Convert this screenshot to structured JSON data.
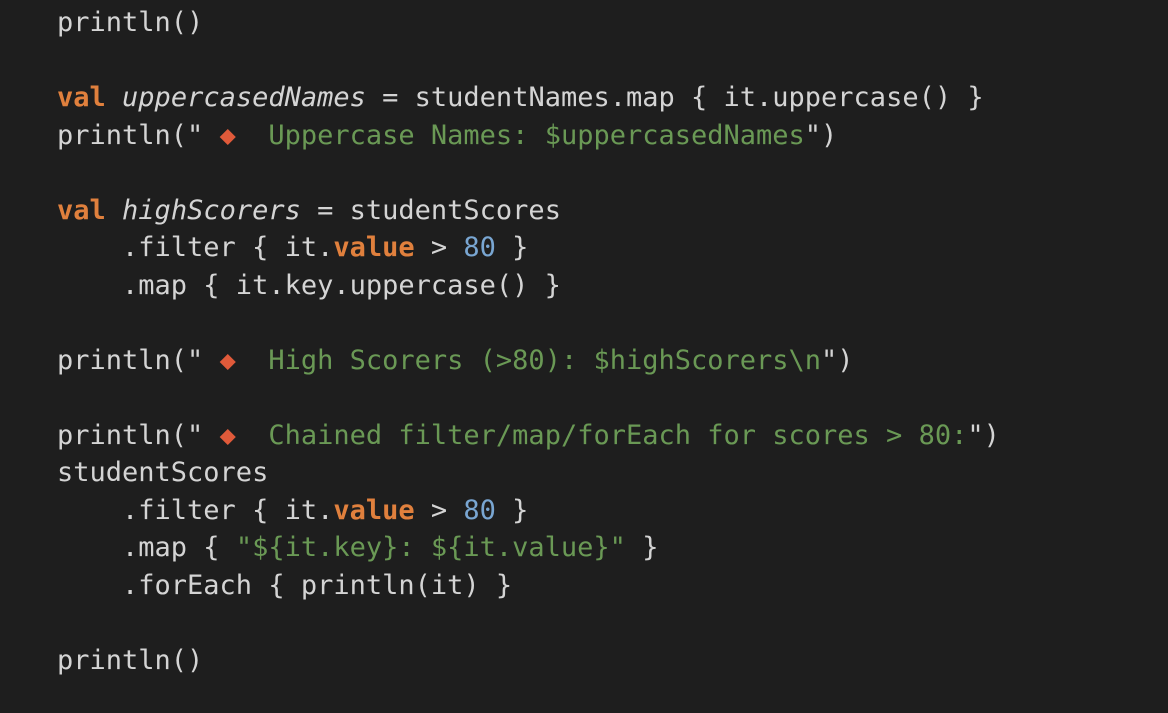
{
  "code_lines": [
    {
      "tokens": [
        {
          "text": "println()",
          "style": "plain"
        }
      ]
    },
    {
      "tokens": []
    },
    {
      "tokens": [
        {
          "text": "val",
          "style": "kw"
        },
        {
          "text": " ",
          "style": "plain"
        },
        {
          "text": "uppercasedNames",
          "style": "ital"
        },
        {
          "text": " = studentNames.map { it.uppercase() }",
          "style": "plain"
        }
      ]
    },
    {
      "tokens": [
        {
          "text": "println(\"",
          "style": "plain"
        },
        {
          "text": " ◆ ",
          "style": "diamond"
        },
        {
          "text": " Uppercase Names: $uppercasedNames",
          "style": "str"
        },
        {
          "text": "\")",
          "style": "plain"
        }
      ]
    },
    {
      "tokens": []
    },
    {
      "tokens": [
        {
          "text": "val",
          "style": "kw"
        },
        {
          "text": " ",
          "style": "plain"
        },
        {
          "text": "highScorers",
          "style": "ital"
        },
        {
          "text": " = studentScores",
          "style": "plain"
        }
      ]
    },
    {
      "tokens": [
        {
          "text": "    .filter { it.",
          "style": "plain"
        },
        {
          "text": "value",
          "style": "kw"
        },
        {
          "text": " > ",
          "style": "plain"
        },
        {
          "text": "80",
          "style": "num"
        },
        {
          "text": " }",
          "style": "plain"
        }
      ]
    },
    {
      "tokens": [
        {
          "text": "    .map { it.key.uppercase() }",
          "style": "plain"
        }
      ]
    },
    {
      "tokens": []
    },
    {
      "tokens": [
        {
          "text": "println(\"",
          "style": "plain"
        },
        {
          "text": " ◆ ",
          "style": "diamond"
        },
        {
          "text": " High Scorers (>80): $highScorers\\n",
          "style": "str"
        },
        {
          "text": "\")",
          "style": "plain"
        }
      ]
    },
    {
      "tokens": []
    },
    {
      "tokens": [
        {
          "text": "println(\"",
          "style": "plain"
        },
        {
          "text": " ◆ ",
          "style": "diamond"
        },
        {
          "text": " Chained filter/map/forEach for scores > 80:",
          "style": "str"
        },
        {
          "text": "\")",
          "style": "plain"
        }
      ]
    },
    {
      "tokens": [
        {
          "text": "studentScores",
          "style": "plain"
        }
      ]
    },
    {
      "tokens": [
        {
          "text": "    .filter { it.",
          "style": "plain"
        },
        {
          "text": "value",
          "style": "kw"
        },
        {
          "text": " > ",
          "style": "plain"
        },
        {
          "text": "80",
          "style": "num"
        },
        {
          "text": " }",
          "style": "plain"
        }
      ]
    },
    {
      "tokens": [
        {
          "text": "    .map { ",
          "style": "plain"
        },
        {
          "text": "\"${it.key}: ${it.value}\"",
          "style": "str"
        },
        {
          "text": " }",
          "style": "plain"
        }
      ]
    },
    {
      "tokens": [
        {
          "text": "    .forEach { println(it) }",
          "style": "plain"
        }
      ]
    },
    {
      "tokens": []
    },
    {
      "tokens": [
        {
          "text": "println()",
          "style": "plain"
        }
      ]
    }
  ]
}
